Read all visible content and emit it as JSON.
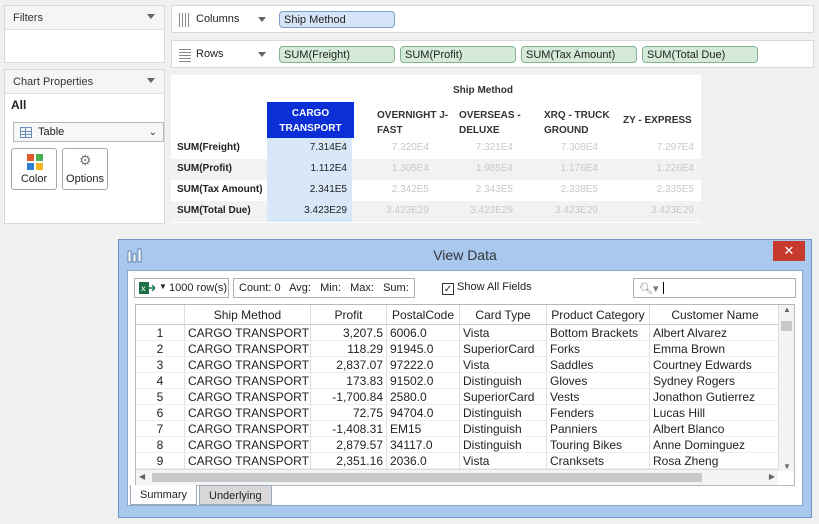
{
  "filters": {
    "title": "Filters"
  },
  "chart_properties": {
    "title": "Chart Properties",
    "scope": "All",
    "chart_type": "Table",
    "color_label": "Color",
    "options_label": "Options"
  },
  "shelves": {
    "columns_label": "Columns",
    "column_pills": [
      "Ship Method"
    ],
    "rows_label": "Rows",
    "row_pills": [
      "SUM(Freight)",
      "SUM(Profit)",
      "SUM(Tax Amount)",
      "SUM(Total Due)"
    ]
  },
  "crosstab": {
    "header": "Ship Method",
    "columns": [
      "CARGO TRANSPORT",
      "OVERNIGHT J-FAST",
      "OVERSEAS - DELUXE",
      "XRQ - TRUCK GROUND",
      "ZY - EXPRESS"
    ],
    "rows": [
      {
        "label": "SUM(Freight)",
        "values": [
          "7.314E4",
          "7.320E4",
          "7.321E4",
          "7.308E4",
          "7.297E4"
        ]
      },
      {
        "label": "SUM(Profit)",
        "values": [
          "1.112E4",
          "1.305E4",
          "1.985E4",
          "1.176E4",
          "1.226E4"
        ]
      },
      {
        "label": "SUM(Tax Amount)",
        "values": [
          "2.341E5",
          "2.342E5",
          "2.343E5",
          "2.338E5",
          "2.335E5"
        ]
      },
      {
        "label": "SUM(Total Due)",
        "values": [
          "3.423E29",
          "3.423E29",
          "3.423E29",
          "3.423E29",
          "3.423E29"
        ]
      }
    ]
  },
  "view_data": {
    "title": "View Data",
    "close": "✕",
    "row_limit": "1000 row(s)",
    "stats": "Count: 0   Avg:   Min:   Max:   Sum:",
    "show_all_fields": "Show All Fields",
    "search_placeholder": "",
    "columns": [
      "Ship Method",
      "Profit",
      "PostalCode",
      "Card Type",
      "Product Category",
      "Customer Name"
    ],
    "rows": [
      [
        "1",
        "CARGO TRANSPORT",
        "3,207.5",
        "6006.0",
        "Vista",
        "Bottom Brackets",
        "Albert Alvarez"
      ],
      [
        "2",
        "CARGO TRANSPORT",
        "118.29",
        "91945.0",
        "SuperiorCard",
        "Forks",
        "Emma Brown"
      ],
      [
        "3",
        "CARGO TRANSPORT",
        "2,837.07",
        "97222.0",
        "Vista",
        "Saddles",
        "Courtney Edwards"
      ],
      [
        "4",
        "CARGO TRANSPORT",
        "173.83",
        "91502.0",
        "Distinguish",
        "Gloves",
        "Sydney Rogers"
      ],
      [
        "5",
        "CARGO TRANSPORT",
        "-1,700.84",
        "2580.0",
        "SuperiorCard",
        "Vests",
        "Jonathon Gutierrez"
      ],
      [
        "6",
        "CARGO TRANSPORT",
        "72.75",
        "94704.0",
        "Distinguish",
        "Fenders",
        "Lucas Hill"
      ],
      [
        "7",
        "CARGO TRANSPORT",
        "-1,408.31",
        "EM15",
        "Distinguish",
        "Panniers",
        "Albert Blanco"
      ],
      [
        "8",
        "CARGO TRANSPORT",
        "2,879.57",
        "34117.0",
        "Distinguish",
        "Touring Bikes",
        "Anne Dominguez"
      ],
      [
        "9",
        "CARGO TRANSPORT",
        "2,351.16",
        "2036.0",
        "Vista",
        "Cranksets",
        "Rosa Zheng"
      ]
    ],
    "tabs": [
      "Summary",
      "Underlying"
    ]
  },
  "colors": {
    "selected_header": "#0b2fd6",
    "dialog_border": "#a9c8ee",
    "close": "#c7382d"
  }
}
